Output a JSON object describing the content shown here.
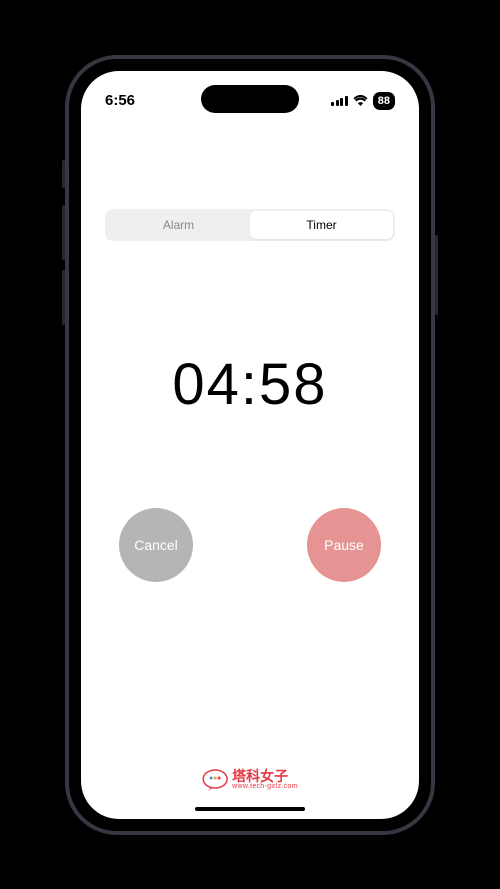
{
  "status": {
    "time": "6:56",
    "battery": "88"
  },
  "tabs": {
    "alarm": "Alarm",
    "timer": "Timer"
  },
  "timer": {
    "display": "04:58"
  },
  "buttons": {
    "cancel": "Cancel",
    "pause": "Pause"
  },
  "logo": {
    "main": "塔科女子",
    "sub": "www.tech-girlz.com"
  },
  "colors": {
    "cancel_bg": "#b5b4b7",
    "pause_bg": "#e59393",
    "accent": "#e63946"
  }
}
